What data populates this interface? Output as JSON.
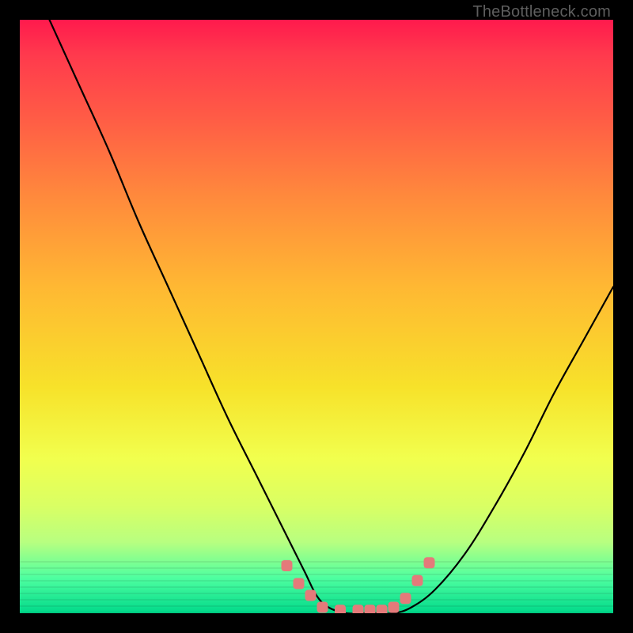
{
  "watermark": "TheBottleneck.com",
  "chart_data": {
    "type": "line",
    "title": "",
    "xlabel": "",
    "ylabel": "",
    "xlim": [
      0,
      100
    ],
    "ylim": [
      0,
      100
    ],
    "grid": false,
    "legend": false,
    "series": [
      {
        "name": "curve",
        "x": [
          5,
          10,
          15,
          20,
          25,
          30,
          35,
          40,
          45,
          48,
          50,
          52,
          55,
          58,
          60,
          63,
          66,
          70,
          75,
          80,
          85,
          90,
          95,
          100
        ],
        "y": [
          100,
          89,
          78,
          66,
          55,
          44,
          33,
          23,
          13,
          7,
          3,
          1,
          0,
          0,
          0,
          0,
          1,
          4,
          10,
          18,
          27,
          37,
          46,
          55
        ]
      }
    ],
    "markers": [
      {
        "x": 45,
        "y": 8
      },
      {
        "x": 47,
        "y": 5
      },
      {
        "x": 49,
        "y": 3
      },
      {
        "x": 51,
        "y": 1
      },
      {
        "x": 54,
        "y": 0.5
      },
      {
        "x": 57,
        "y": 0.5
      },
      {
        "x": 59,
        "y": 0.5
      },
      {
        "x": 61,
        "y": 0.5
      },
      {
        "x": 63,
        "y": 1
      },
      {
        "x": 65,
        "y": 2.5
      },
      {
        "x": 67,
        "y": 5.5
      },
      {
        "x": 69,
        "y": 8.5
      }
    ],
    "marker_color": "#e47a7a",
    "gradient_stops": [
      {
        "pos": 0,
        "color": "#ff1a4d"
      },
      {
        "pos": 50,
        "color": "#ffd233"
      },
      {
        "pos": 78,
        "color": "#f5ff3d"
      },
      {
        "pos": 100,
        "color": "#00d98a"
      }
    ]
  }
}
